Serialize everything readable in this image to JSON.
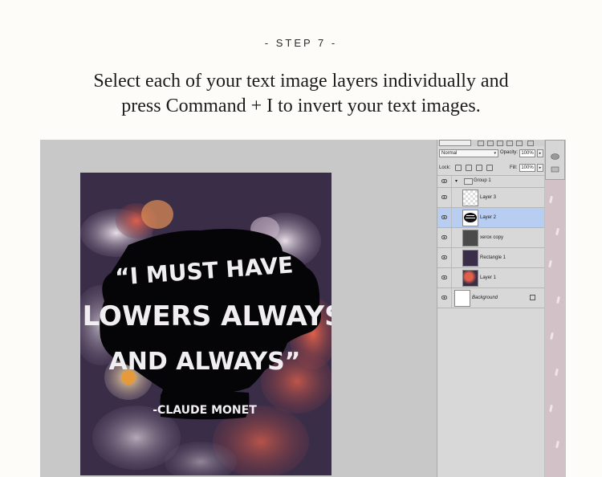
{
  "header": {
    "step_label": "- STEP 7 -",
    "instruction_line1": "Select each of your text image layers individually and",
    "instruction_line2": "press Command + I to invert your text images."
  },
  "artwork": {
    "quote_line1": "“I MUST HAVE",
    "quote_line2": "FLOWERS ALWAYS",
    "quote_line3": "AND ALWAYS”",
    "attribution": "-CLAUDE MONET"
  },
  "layers_panel": {
    "blend_mode": "Normal",
    "opacity_label": "Opacity:",
    "opacity_value": "100%",
    "lock_label": "Lock:",
    "fill_label": "Fill:",
    "fill_value": "100%",
    "layers": [
      {
        "name": "Group 1",
        "type": "group",
        "selected": false
      },
      {
        "name": "Layer 3",
        "type": "layer",
        "selected": false
      },
      {
        "name": "Layer 2",
        "type": "layer",
        "selected": true
      },
      {
        "name": "xerox copy",
        "type": "layer",
        "selected": false
      },
      {
        "name": "Rectangle 1",
        "type": "layer",
        "selected": false
      },
      {
        "name": "Layer 1",
        "type": "layer",
        "selected": false
      },
      {
        "name": "Background",
        "type": "background",
        "selected": false,
        "locked": true
      }
    ]
  },
  "colors": {
    "page_bg": "#fdfcf8",
    "canvas_bg": "#c8c8c8",
    "poster_bg": "#3a2d48",
    "selected_layer": "#b7cdf2",
    "side_pattern": "#d2c2c7"
  }
}
